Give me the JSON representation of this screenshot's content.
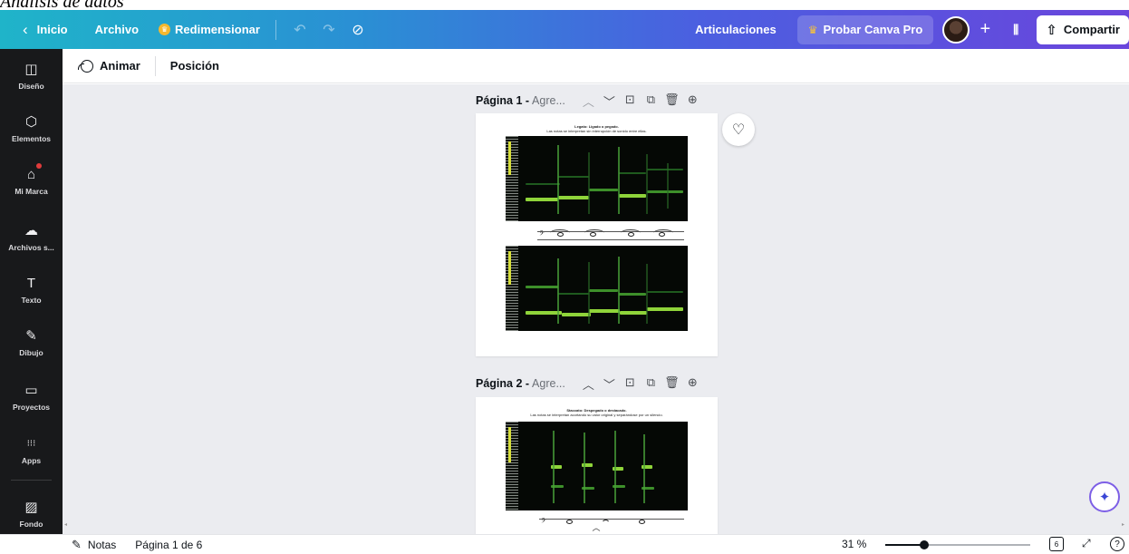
{
  "document": {
    "title_peek": "Análisis de datos"
  },
  "topbar": {
    "home_label": "Inicio",
    "file_label": "Archivo",
    "resize_label": "Redimensionar",
    "undo_icon": "undo-icon",
    "redo_icon": "redo-icon",
    "save_status_icon": "cloud-check-icon",
    "project_title": "Articulaciones",
    "pro_label": "Probar Canva Pro",
    "plus_label": "+",
    "share_label": "Compartir"
  },
  "sidebar": {
    "items": [
      {
        "label": "Diseño",
        "icon": "layout-icon",
        "glyph": "◫"
      },
      {
        "label": "Elementos",
        "icon": "elements-icon",
        "glyph": "⬡"
      },
      {
        "label": "Mi Marca",
        "icon": "brand-icon",
        "glyph": "⌂"
      },
      {
        "label": "Archivos s...",
        "icon": "upload-cloud-icon",
        "glyph": "☁"
      },
      {
        "label": "Texto",
        "icon": "text-icon",
        "glyph": "T"
      },
      {
        "label": "Dibujo",
        "icon": "draw-icon",
        "glyph": "✎"
      },
      {
        "label": "Proyectos",
        "icon": "folder-icon",
        "glyph": "▭"
      },
      {
        "label": "Apps",
        "icon": "apps-grid-icon",
        "glyph": "⁝⁝⁝"
      },
      {
        "label": "Fondo",
        "icon": "background-pattern-icon",
        "glyph": "▨"
      }
    ]
  },
  "context_toolbar": {
    "animate_label": "Animar",
    "position_label": "Posición"
  },
  "pages": [
    {
      "name": "Página 1 -",
      "title_placeholder": "Agre...",
      "caption_line1": "Legato: Ligado o pegado.",
      "caption_line2": "Las notas se interpretan sin interrupción de sonido entre ellas."
    },
    {
      "name": "Página 2 -",
      "title_placeholder": "Agre...",
      "caption_line1": "Staccato: Despegado o destacado.",
      "caption_line2": "Las notas se interpretan acortando su valor original y separándose por un silencio."
    }
  ],
  "bottombar": {
    "notes_label": "Notas",
    "page_indicator": "Página 1 de 6",
    "zoom_label": "31 %",
    "zoom_fraction": 0.27,
    "page_count_badge": "6",
    "help_label": "?"
  },
  "colors": {
    "topbar_gradient_start": "#1fb4c9",
    "topbar_gradient_end": "#6a45dc",
    "sidebar_bg": "#18191b",
    "canvas_bg": "#ebecf0",
    "spectrogram_band": "#8fd43a"
  }
}
